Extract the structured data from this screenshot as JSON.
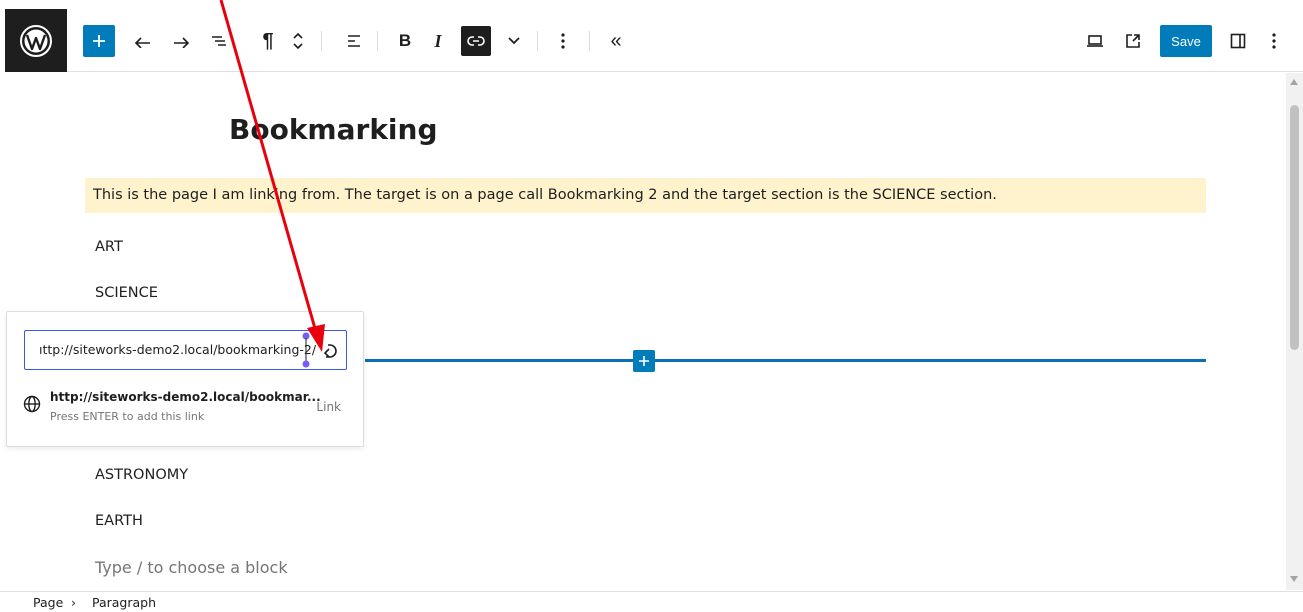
{
  "toolbar": {
    "save_label": "Save",
    "icons": [
      "wordpress-logo",
      "plus-icon",
      "undo-icon",
      "redo-icon",
      "document-overview-icon",
      "paragraph-icon",
      "move-updown-icon",
      "align-left-icon",
      "bold-icon",
      "italic-icon",
      "link-icon",
      "chevron-down-icon",
      "more-options-icon",
      "collapse-icon",
      "desktop-view-icon",
      "external-preview-icon",
      "sidebar-toggle-icon",
      "kebab-menu-icon"
    ],
    "bold_glyph": "B",
    "italic_glyph": "I",
    "paragraph_glyph": "¶",
    "collapse_glyph": "«"
  },
  "editor": {
    "page_title": "Bookmarking",
    "highlighted_paragraph": "This is the page I am linking from. The target is on a page call Bookmarking 2 and the target section is the SCIENCE section.",
    "highlight_color": "#fff3cd",
    "blocks": [
      "ART",
      "SCIENCE",
      "ASTRONOMY",
      "EARTH"
    ],
    "placeholder": "Type / to choose a block"
  },
  "link_popover": {
    "input_value": "ıttp://siteworks-demo2.local/bookmarking-2/",
    "suggestion_url": "http://siteworks-demo2.local/bookmar...",
    "suggestion_hint": "Press ENTER to add this link",
    "suggestion_type": "Link"
  },
  "breadcrumb": {
    "items": [
      "Page",
      "Paragraph"
    ],
    "separator": "›"
  },
  "colors": {
    "accent": "#007cba",
    "annotation_arrow": "#e8000d"
  }
}
